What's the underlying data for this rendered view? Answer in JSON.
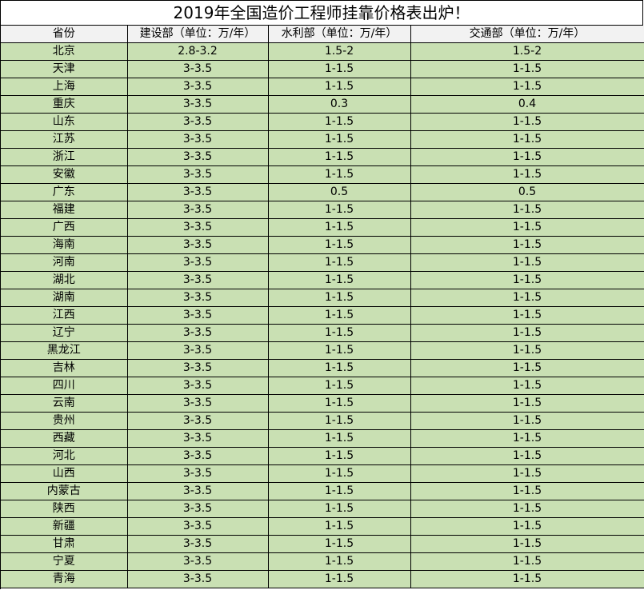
{
  "title": "2019年全国造价工程师挂靠价格表出炉！",
  "headers": [
    "省份",
    "建设部（单位：万/年）",
    "水利部（单位：万/年）",
    "交通部（单位：万/年）"
  ],
  "rows": [
    [
      "北京",
      "2.8-3.2",
      "1.5-2",
      "1.5-2"
    ],
    [
      "天津",
      "3-3.5",
      "1-1.5",
      "1-1.5"
    ],
    [
      "上海",
      "3-3.5",
      "1-1.5",
      "1-1.5"
    ],
    [
      "重庆",
      "3-3.5",
      "0.3",
      "0.4"
    ],
    [
      "山东",
      "3-3.5",
      "1-1.5",
      "1-1.5"
    ],
    [
      "江苏",
      "3-3.5",
      "1-1.5",
      "1-1.5"
    ],
    [
      "浙江",
      "3-3.5",
      "1-1.5",
      "1-1.5"
    ],
    [
      "安徽",
      "3-3.5",
      "1-1.5",
      "1-1.5"
    ],
    [
      "广东",
      "3-3.5",
      "0.5",
      "0.5"
    ],
    [
      "福建",
      "3-3.5",
      "1-1.5",
      "1-1.5"
    ],
    [
      "广西",
      "3-3.5",
      "1-1.5",
      "1-1.5"
    ],
    [
      "海南",
      "3-3.5",
      "1-1.5",
      "1-1.5"
    ],
    [
      "河南",
      "3-3.5",
      "1-1.5",
      "1-1.5"
    ],
    [
      "湖北",
      "3-3.5",
      "1-1.5",
      "1-1.5"
    ],
    [
      "湖南",
      "3-3.5",
      "1-1.5",
      "1-1.5"
    ],
    [
      "江西",
      "3-3.5",
      "1-1.5",
      "1-1.5"
    ],
    [
      "辽宁",
      "3-3.5",
      "1-1.5",
      "1-1.5"
    ],
    [
      "黑龙江",
      "3-3.5",
      "1-1.5",
      "1-1.5"
    ],
    [
      "吉林",
      "3-3.5",
      "1-1.5",
      "1-1.5"
    ],
    [
      "四川",
      "3-3.5",
      "1-1.5",
      "1-1.5"
    ],
    [
      "云南",
      "3-3.5",
      "1-1.5",
      "1-1.5"
    ],
    [
      "贵州",
      "3-3.5",
      "1-1.5",
      "1-1.5"
    ],
    [
      "西藏",
      "3-3.5",
      "1-1.5",
      "1-1.5"
    ],
    [
      "河北",
      "3-3.5",
      "1-1.5",
      "1-1.5"
    ],
    [
      "山西",
      "3-3.5",
      "1-1.5",
      "1-1.5"
    ],
    [
      "内蒙古",
      "3-3.5",
      "1-1.5",
      "1-1.5"
    ],
    [
      "陕西",
      "3-3.5",
      "1-1.5",
      "1-1.5"
    ],
    [
      "新疆",
      "3-3.5",
      "1-1.5",
      "1-1.5"
    ],
    [
      "甘肃",
      "3-3.5",
      "1-1.5",
      "1-1.5"
    ],
    [
      "宁夏",
      "3-3.5",
      "1-1.5",
      "1-1.5"
    ],
    [
      "青海",
      "3-3.5",
      "1-1.5",
      "1-1.5"
    ]
  ],
  "colors": {
    "row_background": "#c9e0b3",
    "header_background": "#f2f2f2",
    "title_background": "#ffffff",
    "grid_lines": "#000000"
  }
}
